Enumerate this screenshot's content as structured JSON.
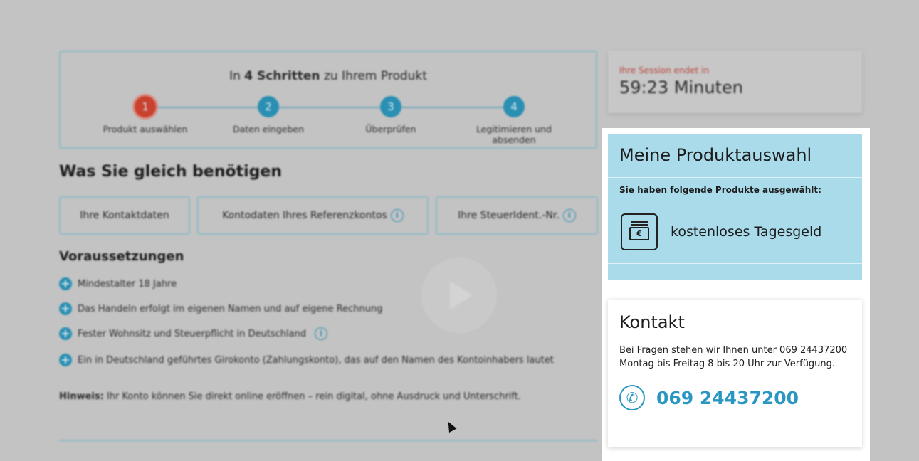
{
  "stepper": {
    "title_prefix": "In ",
    "title_bold": "4 Schritten",
    "title_suffix": " zu Ihrem Produkt",
    "steps": [
      {
        "number": "1",
        "label": "Produkt auswählen"
      },
      {
        "number": "2",
        "label": "Daten eingeben"
      },
      {
        "number": "3",
        "label": "Überprüfen"
      },
      {
        "number": "4",
        "label": "Legitimieren und absenden"
      }
    ]
  },
  "needs": {
    "title": "Was Sie gleich benötigen",
    "items": [
      "Ihre Kontaktdaten",
      "Kontodaten Ihres Referenzkontos",
      "Ihre SteuerIdent.-Nr."
    ]
  },
  "requirements": {
    "title": "Voraussetzungen",
    "items": [
      "Mindestalter 18 Jahre",
      "Das Handeln erfolgt im eigenen Namen und auf eigene Rechnung",
      "Fester Wohnsitz und Steuerpflicht in Deutschland",
      "Ein in Deutschland geführtes Girokonto (Zahlungskonto), das auf den Namen des Kontoinhabers lautet"
    ]
  },
  "note": {
    "label": "Hinweis:",
    "text": " Ihr Konto können Sie direkt online eröffnen – rein digital, ohne Ausdruck und Unterschrift."
  },
  "session": {
    "label": "Ihre Session endet in",
    "time": "59:23 Minuten"
  },
  "product_selection": {
    "title": "Meine Produktauswahl",
    "subtitle": "Sie haben folgende Produkte ausgewählt:",
    "product_name": "kostenloses Tagesgeld",
    "product_icon": "money-bills-icon",
    "currency_symbol": "€"
  },
  "contact": {
    "title": "Kontakt",
    "text": "Bei Fragen stehen wir Ihnen unter 069 24437200 Montag bis Freitag 8 bis 20 Uhr zur Verfügung.",
    "phone": "069 24437200"
  },
  "colors": {
    "accent": "#2a97c2",
    "product_card_bg": "#a9dbea",
    "active_step": "#c9412f",
    "overlay": "#c3c3c3"
  }
}
